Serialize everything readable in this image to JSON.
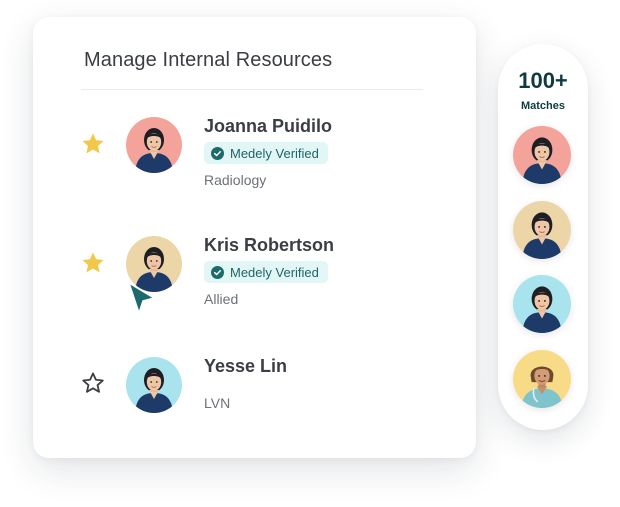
{
  "panel": {
    "title": "Manage Internal Resources",
    "resources": [
      {
        "name": "Joanna Puidilo",
        "badge": "Medely Verified",
        "department": "Radiology",
        "starred": true,
        "avatar_bg": "#f4a39a"
      },
      {
        "name": "Kris Robertson",
        "badge": "Medely Verified",
        "department": "Allied",
        "starred": true,
        "avatar_bg": "#ecd6a8"
      },
      {
        "name": "Yesse Lin",
        "department": "LVN",
        "starred": false,
        "avatar_bg": "#a8e3ee"
      }
    ]
  },
  "matches": {
    "count": "100+",
    "label": "Matches",
    "avatar_bgs": [
      "#f4a39a",
      "#ecd6a8",
      "#a8e3ee",
      "#f8db87"
    ]
  },
  "colors": {
    "star_filled": "#f2c84b",
    "star_outline": "#3d4046",
    "badge_bg": "#e3f6f6",
    "badge_text": "#1f6467",
    "check": "#1d6a6c",
    "cursor": "#1d6a6c",
    "matches_text": "#0f3a42"
  }
}
